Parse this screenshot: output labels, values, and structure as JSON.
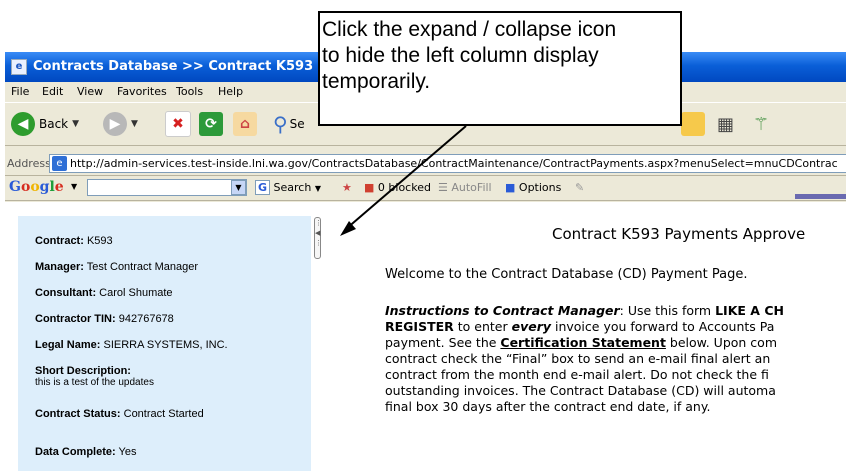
{
  "window": {
    "title": "Contracts Database >> Contract K593 Pa"
  },
  "menu": [
    "File",
    "Edit",
    "View",
    "Favorites",
    "Tools",
    "Help"
  ],
  "toolbar": {
    "back_label": "Back",
    "search_partial": "Se"
  },
  "address": {
    "label": "Address",
    "url": "http://admin-services.test-inside.lni.wa.gov/ContractsDatabase/ContractMaintenance/ContractPayments.aspx?menuSelect=mnuCDContrac"
  },
  "googlebar": {
    "logo": [
      "G",
      "o",
      "o",
      "g",
      "l",
      "e"
    ],
    "search_label": "Search",
    "blocked_label": "0 blocked",
    "autofill_label": "AutoFill",
    "options_label": "Options"
  },
  "contract": {
    "contract_label": "Contract:",
    "contract_value": "K593",
    "manager_label": "Manager:",
    "manager_value": "Test Contract Manager",
    "consultant_label": "Consultant:",
    "consultant_value": "Carol Shumate",
    "tin_label": "Contractor TIN:",
    "tin_value": "942767678",
    "legal_label": "Legal Name:",
    "legal_value": "SIERRA SYSTEMS, INC.",
    "desc_label": "Short Description:",
    "desc_value": "this is a test of the updates",
    "status_label": "Contract Status:",
    "status_value": "Contract Started",
    "complete_label": "Data Complete:",
    "complete_value": "Yes"
  },
  "main": {
    "title": "Contract K593 Payments Approve",
    "welcome": "Welcome to the Contract Database (CD) Payment Page.",
    "instr_label": "Instructions to Contract Manager",
    "line1_a": ": Use this form ",
    "line1_b": "LIKE A CH",
    "line2_a": "REGISTER",
    "line2_b": " to enter ",
    "line2_c": "every",
    "line2_d": " invoice you forward to Accounts Pa",
    "line3_a": "payment. See the ",
    "line3_b": "Certification Statement",
    "line3_c": " below. Upon com",
    "line4": "contract check the “Final” box to send an e-mail final alert an",
    "line5": "contract from the month end e-mail alert. Do not check the fi",
    "line6": "outstanding invoices. The Contract Database (CD) will automa",
    "line7": "final box 30 days after the contract end date, if any."
  },
  "callout": {
    "line1": "Click the expand / collapse icon",
    "line2": "to hide the left column display",
    "line3": "temporarily."
  },
  "colors": {
    "titlebar": "#0a5fd8",
    "left_panel": "#ddeefb",
    "chrome": "#ece9d8"
  }
}
